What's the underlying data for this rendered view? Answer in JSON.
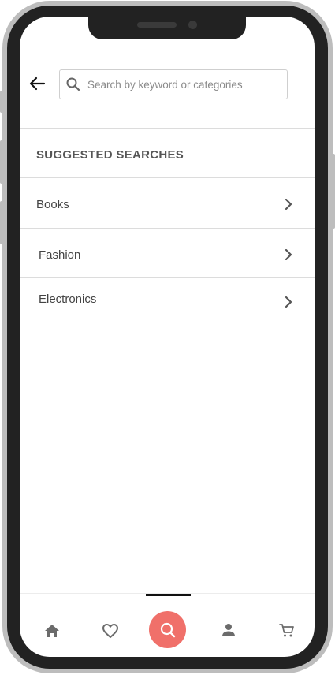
{
  "header": {
    "back_icon": "arrow-left-icon",
    "search": {
      "placeholder": "Search by keyword or categories",
      "value": "",
      "icon": "search-icon"
    }
  },
  "suggestions": {
    "title": "SUGGESTED SEARCHES",
    "items": [
      {
        "label": "Books",
        "icon": "chevron-right-icon"
      },
      {
        "label": "Fashion",
        "icon": "chevron-right-icon"
      },
      {
        "label": "Electronics",
        "icon": "chevron-right-icon"
      }
    ]
  },
  "bottom_nav": {
    "items": [
      {
        "name": "home",
        "icon": "home-icon"
      },
      {
        "name": "favorites",
        "icon": "heart-icon"
      },
      {
        "name": "search",
        "icon": "search-icon",
        "active": true
      },
      {
        "name": "profile",
        "icon": "person-icon"
      },
      {
        "name": "cart",
        "icon": "cart-icon"
      }
    ]
  },
  "colors": {
    "accent": "#f0706a",
    "text": "#444444",
    "divider": "#dcdcdc",
    "icon": "#6b6b6b"
  }
}
